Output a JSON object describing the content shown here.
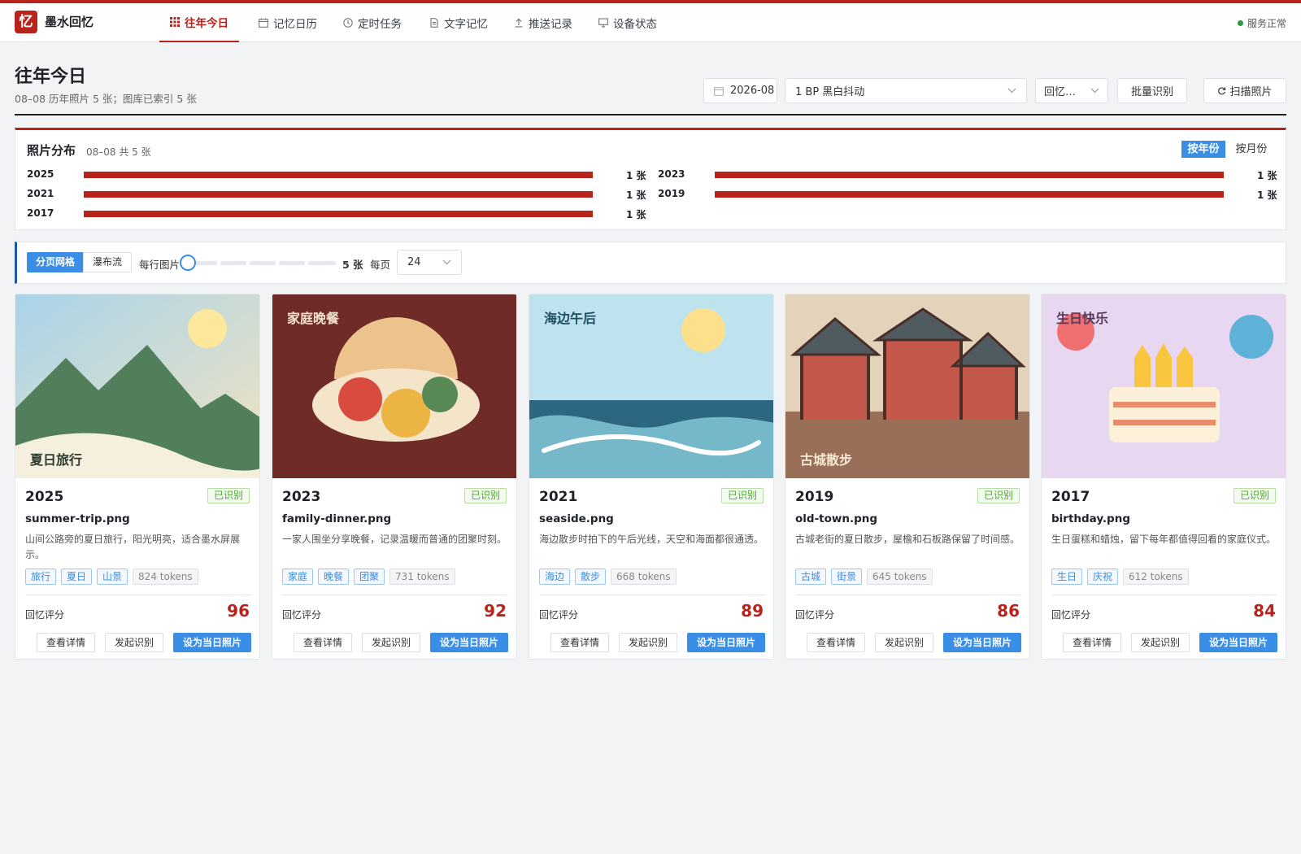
{
  "app": {
    "logo_char": "忆",
    "name": "墨水回忆"
  },
  "nav": {
    "tabs": [
      {
        "label": "往年今日",
        "icon": "grid-icon"
      },
      {
        "label": "记忆日历",
        "icon": "calendar-icon"
      },
      {
        "label": "定时任务",
        "icon": "clock-icon"
      },
      {
        "label": "文字记忆",
        "icon": "document-icon"
      },
      {
        "label": "推送记录",
        "icon": "upload-icon"
      },
      {
        "label": "设备状态",
        "icon": "monitor-icon"
      }
    ],
    "status": "服务正常"
  },
  "header": {
    "title": "往年今日",
    "subtitle": "08–08 历年照片 5 张；图库已索引 5 张",
    "date_value": "2026-08",
    "dither_select": "1 BP 黑白抖动",
    "sort_select": "回忆…",
    "batch_button": "批量识别",
    "scan_button": "扫描照片"
  },
  "distribution": {
    "title": "照片分布",
    "subtitle": "08–08 共 5 张",
    "by_year": "按年份",
    "by_month": "按月份",
    "rows": [
      {
        "year": "2025",
        "count": "1 张",
        "fraction": 1
      },
      {
        "year": "2023",
        "count": "1 张",
        "fraction": 1
      },
      {
        "year": "2021",
        "count": "1 张",
        "fraction": 1
      },
      {
        "year": "2019",
        "count": "1 张",
        "fraction": 1
      },
      {
        "year": "2017",
        "count": "1 张",
        "fraction": 1
      }
    ]
  },
  "view": {
    "grid_mode": "分页网格",
    "waterfall_mode": "瀑布流",
    "per_row_label": "每行图片",
    "per_row_value": "5 张",
    "per_page_label": "每页",
    "per_page_value": "24"
  },
  "cards": [
    {
      "year": "2025",
      "status": "已识别",
      "file": "summer-trip.png",
      "desc": "山间公路旁的夏日旅行，阳光明亮，适合墨水屏展示。",
      "tags": [
        "旅行",
        "夏日",
        "山景"
      ],
      "tokens": "824 tokens",
      "score_label": "回忆评分",
      "score": "96",
      "overlay": "夏日旅行",
      "btn_detail": "查看详情",
      "btn_recognize": "发起识别",
      "btn_set": "设为当日照片"
    },
    {
      "year": "2023",
      "status": "已识别",
      "file": "family-dinner.png",
      "desc": "一家人围坐分享晚餐，记录温暖而普通的团聚时刻。",
      "tags": [
        "家庭",
        "晚餐",
        "团聚"
      ],
      "tokens": "731 tokens",
      "score_label": "回忆评分",
      "score": "92",
      "overlay": "家庭晚餐",
      "btn_detail": "查看详情",
      "btn_recognize": "发起识别",
      "btn_set": "设为当日照片"
    },
    {
      "year": "2021",
      "status": "已识别",
      "file": "seaside.png",
      "desc": "海边散步时拍下的午后光线，天空和海面都很通透。",
      "tags": [
        "海边",
        "散步"
      ],
      "tokens": "668 tokens",
      "score_label": "回忆评分",
      "score": "89",
      "overlay": "海边午后",
      "btn_detail": "查看详情",
      "btn_recognize": "发起识别",
      "btn_set": "设为当日照片"
    },
    {
      "year": "2019",
      "status": "已识别",
      "file": "old-town.png",
      "desc": "古城老街的夏日散步，屋檐和石板路保留了时间感。",
      "tags": [
        "古城",
        "街景"
      ],
      "tokens": "645 tokens",
      "score_label": "回忆评分",
      "score": "86",
      "overlay": "古城散步",
      "btn_detail": "查看详情",
      "btn_recognize": "发起识别",
      "btn_set": "设为当日照片"
    },
    {
      "year": "2017",
      "status": "已识别",
      "file": "birthday.png",
      "desc": "生日蛋糕和蜡烛，留下每年都值得回看的家庭仪式。",
      "tags": [
        "生日",
        "庆祝"
      ],
      "tokens": "612 tokens",
      "score_label": "回忆评分",
      "score": "84",
      "overlay": "生日快乐",
      "btn_detail": "查看详情",
      "btn_recognize": "发起识别",
      "btn_set": "设为当日照片"
    }
  ],
  "colors": {
    "brand": "#b8241c",
    "accent": "#3a8ee6",
    "success": "#52a535"
  }
}
